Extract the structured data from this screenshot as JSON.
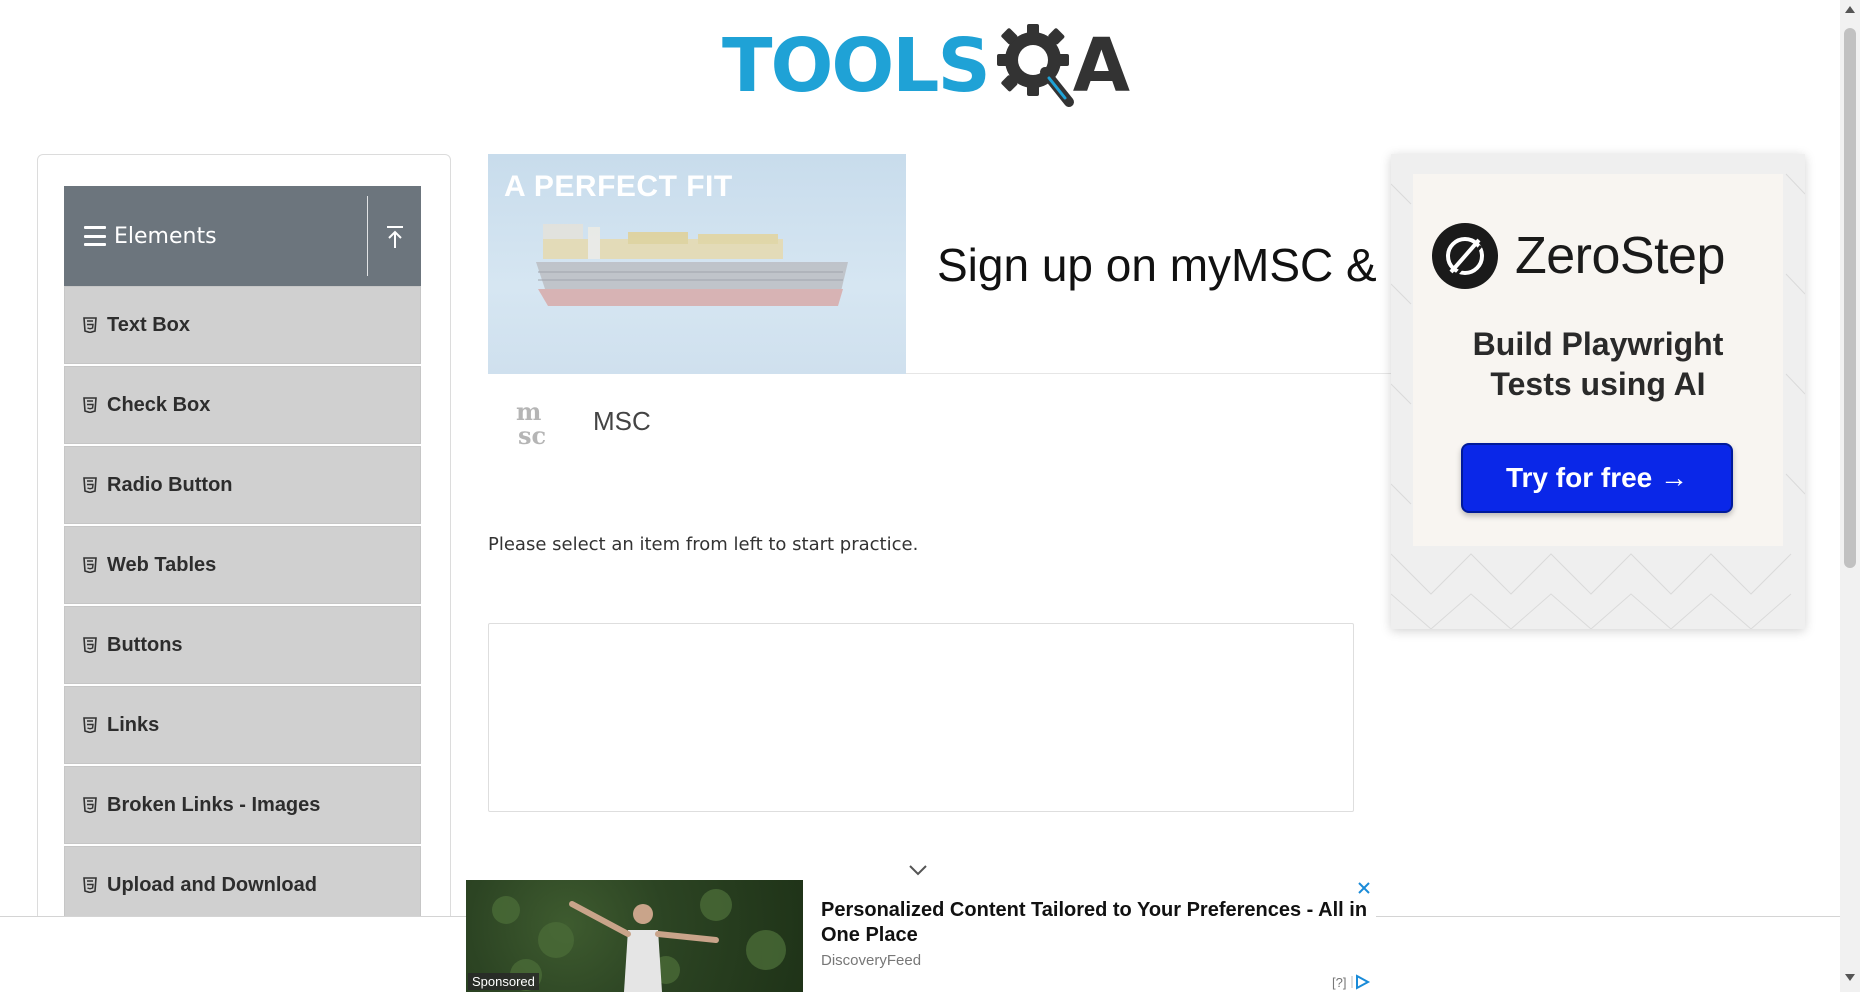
{
  "header": {
    "logo_text_main": "TOOLS",
    "logo_text_end": "A",
    "brand_color": "#1fa2d6",
    "gear_color": "#333333"
  },
  "sidebar": {
    "group": {
      "title": "Elements",
      "icon": "hamburger-icon",
      "toggle_icon": "collapse-up-icon",
      "bg_color": "#6c757d"
    },
    "items": [
      {
        "label": "Text Box",
        "icon": "html5-icon"
      },
      {
        "label": "Check Box",
        "icon": "html5-icon"
      },
      {
        "label": "Radio Button",
        "icon": "html5-icon"
      },
      {
        "label": "Web Tables",
        "icon": "html5-icon"
      },
      {
        "label": "Buttons",
        "icon": "html5-icon"
      },
      {
        "label": "Links",
        "icon": "html5-icon"
      },
      {
        "label": "Broken Links - Images",
        "icon": "html5-icon"
      },
      {
        "label": "Upload and Download",
        "icon": "html5-icon"
      }
    ]
  },
  "banner_ad": {
    "image_tagline": "A PERFECT FIT",
    "headline": "Sign up on myMSC & B",
    "advertiser": "MSC"
  },
  "main": {
    "instruction": "Please select an item from left to start practice."
  },
  "right_ad": {
    "brand": "ZeroStep",
    "tagline_line1": "Build Playwright",
    "tagline_line2": "Tests using AI",
    "cta": "Try for free →",
    "cta_color": "#0a27e8"
  },
  "bottom_ad": {
    "sponsored_label": "Sponsored",
    "title": "Personalized Content Tailored to Your Preferences - All in One Place",
    "source": "DiscoveryFeed",
    "adchoices_label": "[?]"
  }
}
